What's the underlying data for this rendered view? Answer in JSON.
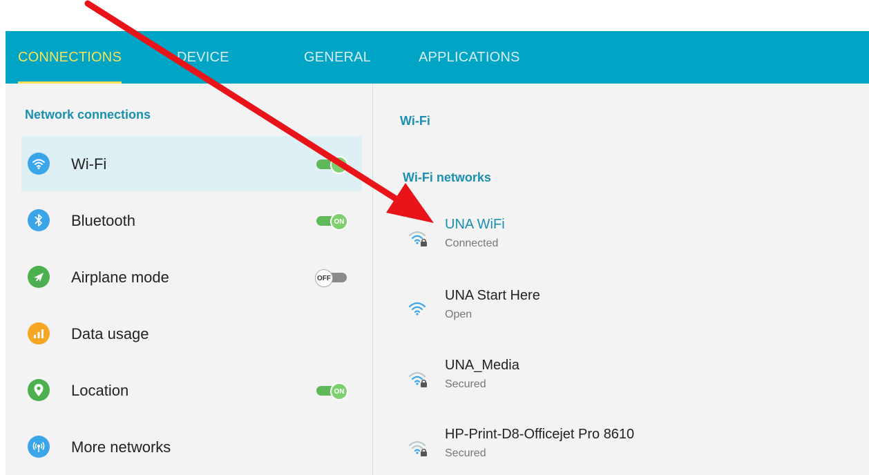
{
  "tabs": [
    {
      "label": "CONNECTIONS",
      "active": true
    },
    {
      "label": "DEVICE",
      "active": false
    },
    {
      "label": "GENERAL",
      "active": false
    },
    {
      "label": "APPLICATIONS",
      "active": false
    }
  ],
  "left_panel": {
    "section_title": "Network connections",
    "items": [
      {
        "label": "Wi-Fi",
        "icon": "wifi-icon",
        "icon_color": "#3aa5e8",
        "toggle": "on",
        "toggle_label": "",
        "selected": true
      },
      {
        "label": "Bluetooth",
        "icon": "bluetooth-icon",
        "icon_color": "#3aa5e8",
        "toggle": "on",
        "toggle_label": "ON",
        "selected": false
      },
      {
        "label": "Airplane mode",
        "icon": "airplane-icon",
        "icon_color": "#4caf50",
        "toggle": "off",
        "toggle_label": "OFF",
        "selected": false
      },
      {
        "label": "Data usage",
        "icon": "data-usage-icon",
        "icon_color": "#f5a623",
        "toggle": null,
        "toggle_label": "",
        "selected": false
      },
      {
        "label": "Location",
        "icon": "location-icon",
        "icon_color": "#4caf50",
        "toggle": "on",
        "toggle_label": "ON",
        "selected": false
      },
      {
        "label": "More networks",
        "icon": "more-networks-icon",
        "icon_color": "#3aa5e8",
        "toggle": null,
        "toggle_label": "",
        "selected": false
      }
    ]
  },
  "right_panel": {
    "title": "Wi-Fi",
    "section_title": "Wi-Fi networks",
    "networks": [
      {
        "name": "UNA WiFi",
        "status": "Connected",
        "icon": "wifi-lock-icon",
        "connected": true
      },
      {
        "name": "UNA Start Here",
        "status": "Open",
        "icon": "wifi-icon",
        "connected": false
      },
      {
        "name": "UNA_Media",
        "status": "Secured",
        "icon": "wifi-lock-icon",
        "connected": false
      },
      {
        "name": "HP-Print-D8-Officejet Pro 8610",
        "status": "Secured",
        "icon": "wifi-lock-icon",
        "connected": false
      }
    ]
  },
  "colors": {
    "tab_bar": "#00a5c5",
    "active_tab": "#f7e35a",
    "accent": "#1a8fb0",
    "annotation_arrow": "#e8141a"
  }
}
